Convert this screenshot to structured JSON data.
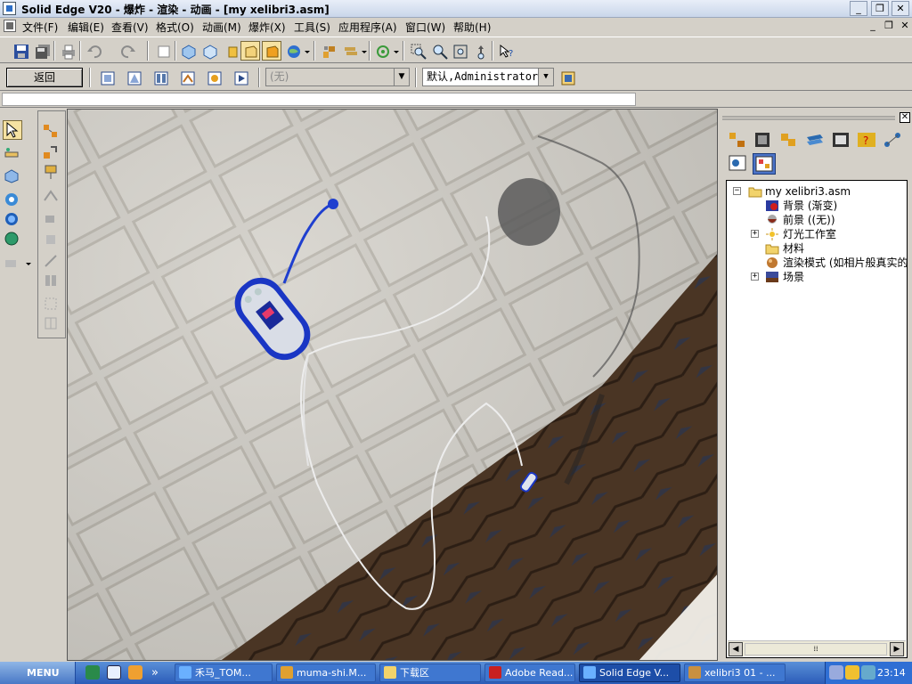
{
  "window": {
    "title": "Solid Edge V20 - 爆炸 - 渲染 - 动画 - [my xelibri3.asm]",
    "minimize_glyph": "_",
    "restore_glyph": "❐",
    "close_glyph": "✕"
  },
  "menubar": {
    "items": [
      {
        "label": "文件(F)"
      },
      {
        "label": "编辑(E)"
      },
      {
        "label": "查看(V)"
      },
      {
        "label": "格式(O)"
      },
      {
        "label": "动画(M)"
      },
      {
        "label": "爆炸(X)"
      },
      {
        "label": "工具(S)"
      },
      {
        "label": "应用程序(A)"
      },
      {
        "label": "窗口(W)"
      },
      {
        "label": "帮助(H)"
      }
    ]
  },
  "toolbar2": {
    "back_label": "返回",
    "disabled_combo_value": "(无)",
    "user_combo_value": "默认,Administrator"
  },
  "tree": {
    "items": [
      {
        "label": "my xelibri3.asm",
        "icon": "folder-icon"
      },
      {
        "label": "背景 (渐变)",
        "icon": "background-icon"
      },
      {
        "label": "前景 ((无))",
        "icon": "foreground-icon"
      },
      {
        "label": "灯光工作室",
        "icon": "light-studio-icon"
      },
      {
        "label": "材料",
        "icon": "materials-folder-icon"
      },
      {
        "label": "渲染模式 (如相片般真实的",
        "icon": "render-mode-icon"
      },
      {
        "label": "场景",
        "icon": "scene-icon"
      }
    ],
    "scroll_grip": "⁞⁞"
  },
  "taskbar": {
    "start_label": "MENU",
    "chevron": "»",
    "tasks": [
      {
        "label": "禾马_TOM..."
      },
      {
        "label": "muma-shi.M..."
      },
      {
        "label": "下载区"
      },
      {
        "label": "Adobe Read..."
      },
      {
        "label": "Solid Edge V..."
      },
      {
        "label": "xelibri3 01 - ..."
      }
    ],
    "clock": "23:14"
  },
  "colors": {
    "accent_blue": "#1f3fcf",
    "roof_brown": "#4a3524",
    "wall_grey": "#cfccc5"
  }
}
